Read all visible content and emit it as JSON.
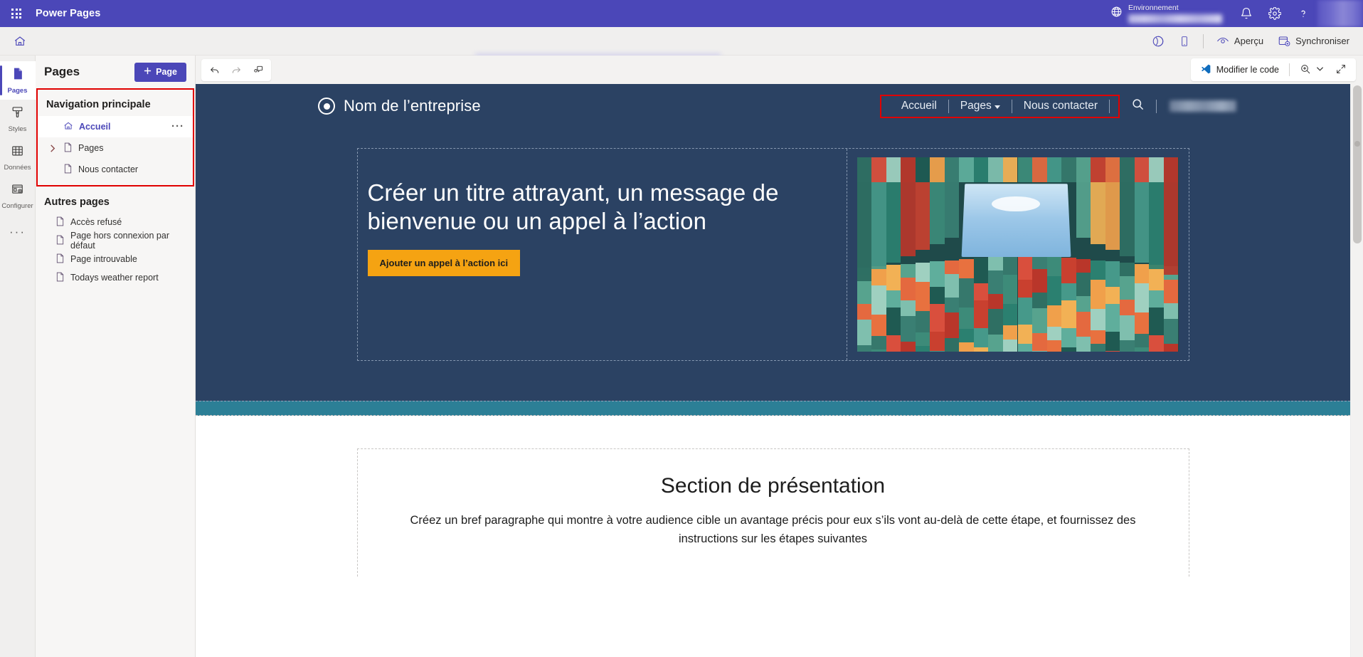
{
  "topbar": {
    "waffle_icon": "app-launcher-icon",
    "app_title": "Power Pages",
    "globe_icon": "globe-icon",
    "env_label": "Environnement",
    "env_value": "",
    "bell_icon": "notifications-icon",
    "gear_icon": "settings-icon",
    "help_icon": "help-icon",
    "avatar": ""
  },
  "commandbar": {
    "home_icon": "home-icon",
    "site_name": "",
    "right_items": [
      {
        "name": "theme-icon",
        "label": "",
        "icon": "palette-icon"
      },
      {
        "name": "device-preview-icon",
        "label": "",
        "icon": "mobile-icon"
      },
      {
        "name": "preview-button",
        "label": "Aperçu",
        "icon": "eye-icon"
      },
      {
        "name": "sync-button",
        "label": "Synchroniser",
        "icon": "sync-icon"
      }
    ]
  },
  "rail": {
    "items": [
      {
        "label": "Pages",
        "icon": "page-icon",
        "active": true
      },
      {
        "label": "Styles",
        "icon": "brush-icon",
        "active": false
      },
      {
        "label": "Données",
        "icon": "table-icon",
        "active": false
      },
      {
        "label": "Configurer",
        "icon": "setup-icon",
        "active": false
      }
    ],
    "more_label": "···"
  },
  "panel": {
    "title": "Pages",
    "add_button": "Page",
    "add_icon": "plus-icon",
    "main_nav": {
      "title": "Navigation principale",
      "highlighted": true,
      "highlight_color": "#e00000",
      "items": [
        {
          "label": "Accueil",
          "icon": "home-icon",
          "selected": true,
          "expandable": false,
          "has_more": true
        },
        {
          "label": "Pages",
          "icon": "page-icon",
          "selected": false,
          "expandable": true,
          "has_more": false
        },
        {
          "label": "Nous contacter",
          "icon": "page-icon",
          "selected": false,
          "expandable": false,
          "has_more": false
        }
      ]
    },
    "other_pages": {
      "title": "Autres pages",
      "items": [
        {
          "label": "Accès refusé",
          "icon": "page-icon"
        },
        {
          "label": "Page hors connexion par défaut",
          "icon": "page-icon"
        },
        {
          "label": "Page introuvable",
          "icon": "page-icon"
        },
        {
          "label": "Todays weather report",
          "icon": "page-icon"
        }
      ]
    }
  },
  "canvas_toolbar": {
    "left": [
      {
        "name": "undo-button",
        "icon": "undo-icon"
      },
      {
        "name": "redo-button",
        "icon": "redo-icon"
      },
      {
        "name": "comments-button",
        "icon": "comment-icon"
      }
    ],
    "edit_code_label": "Modifier le code",
    "edit_code_icon": "vscode-icon",
    "zoom_icon": "zoom-in-icon",
    "zoom_chevron": "chevron-down-icon",
    "expand_icon": "expand-icon"
  },
  "site": {
    "brand": {
      "logo_icon": "circle-target-logo",
      "name": "Nom de l’entreprise"
    },
    "nav": {
      "highlighted": true,
      "highlight_color": "#e00000",
      "links": [
        {
          "label": "Accueil",
          "dropdown": false
        },
        {
          "label": "Pages",
          "dropdown": true
        },
        {
          "label": "Nous contacter",
          "dropdown": false
        }
      ],
      "search_icon": "search-icon",
      "user_name": ""
    },
    "hero": {
      "title": "Créer un titre attrayant, un message de bienvenue ou un appel à l’action",
      "cta_label": "Ajouter un appel à l’action ici",
      "image_alt": "colorful-architecture-photo",
      "bg_color": "#2b4263",
      "cta_color": "#f5a312"
    },
    "band_color": "#2c7f96",
    "section": {
      "title": "Section de présentation",
      "paragraph": "Créez un bref paragraphe qui montre à votre audience cible un avantage précis pour eux s’ils vont au-delà de cette étape, et fournissez des instructions sur les étapes suivantes"
    }
  }
}
